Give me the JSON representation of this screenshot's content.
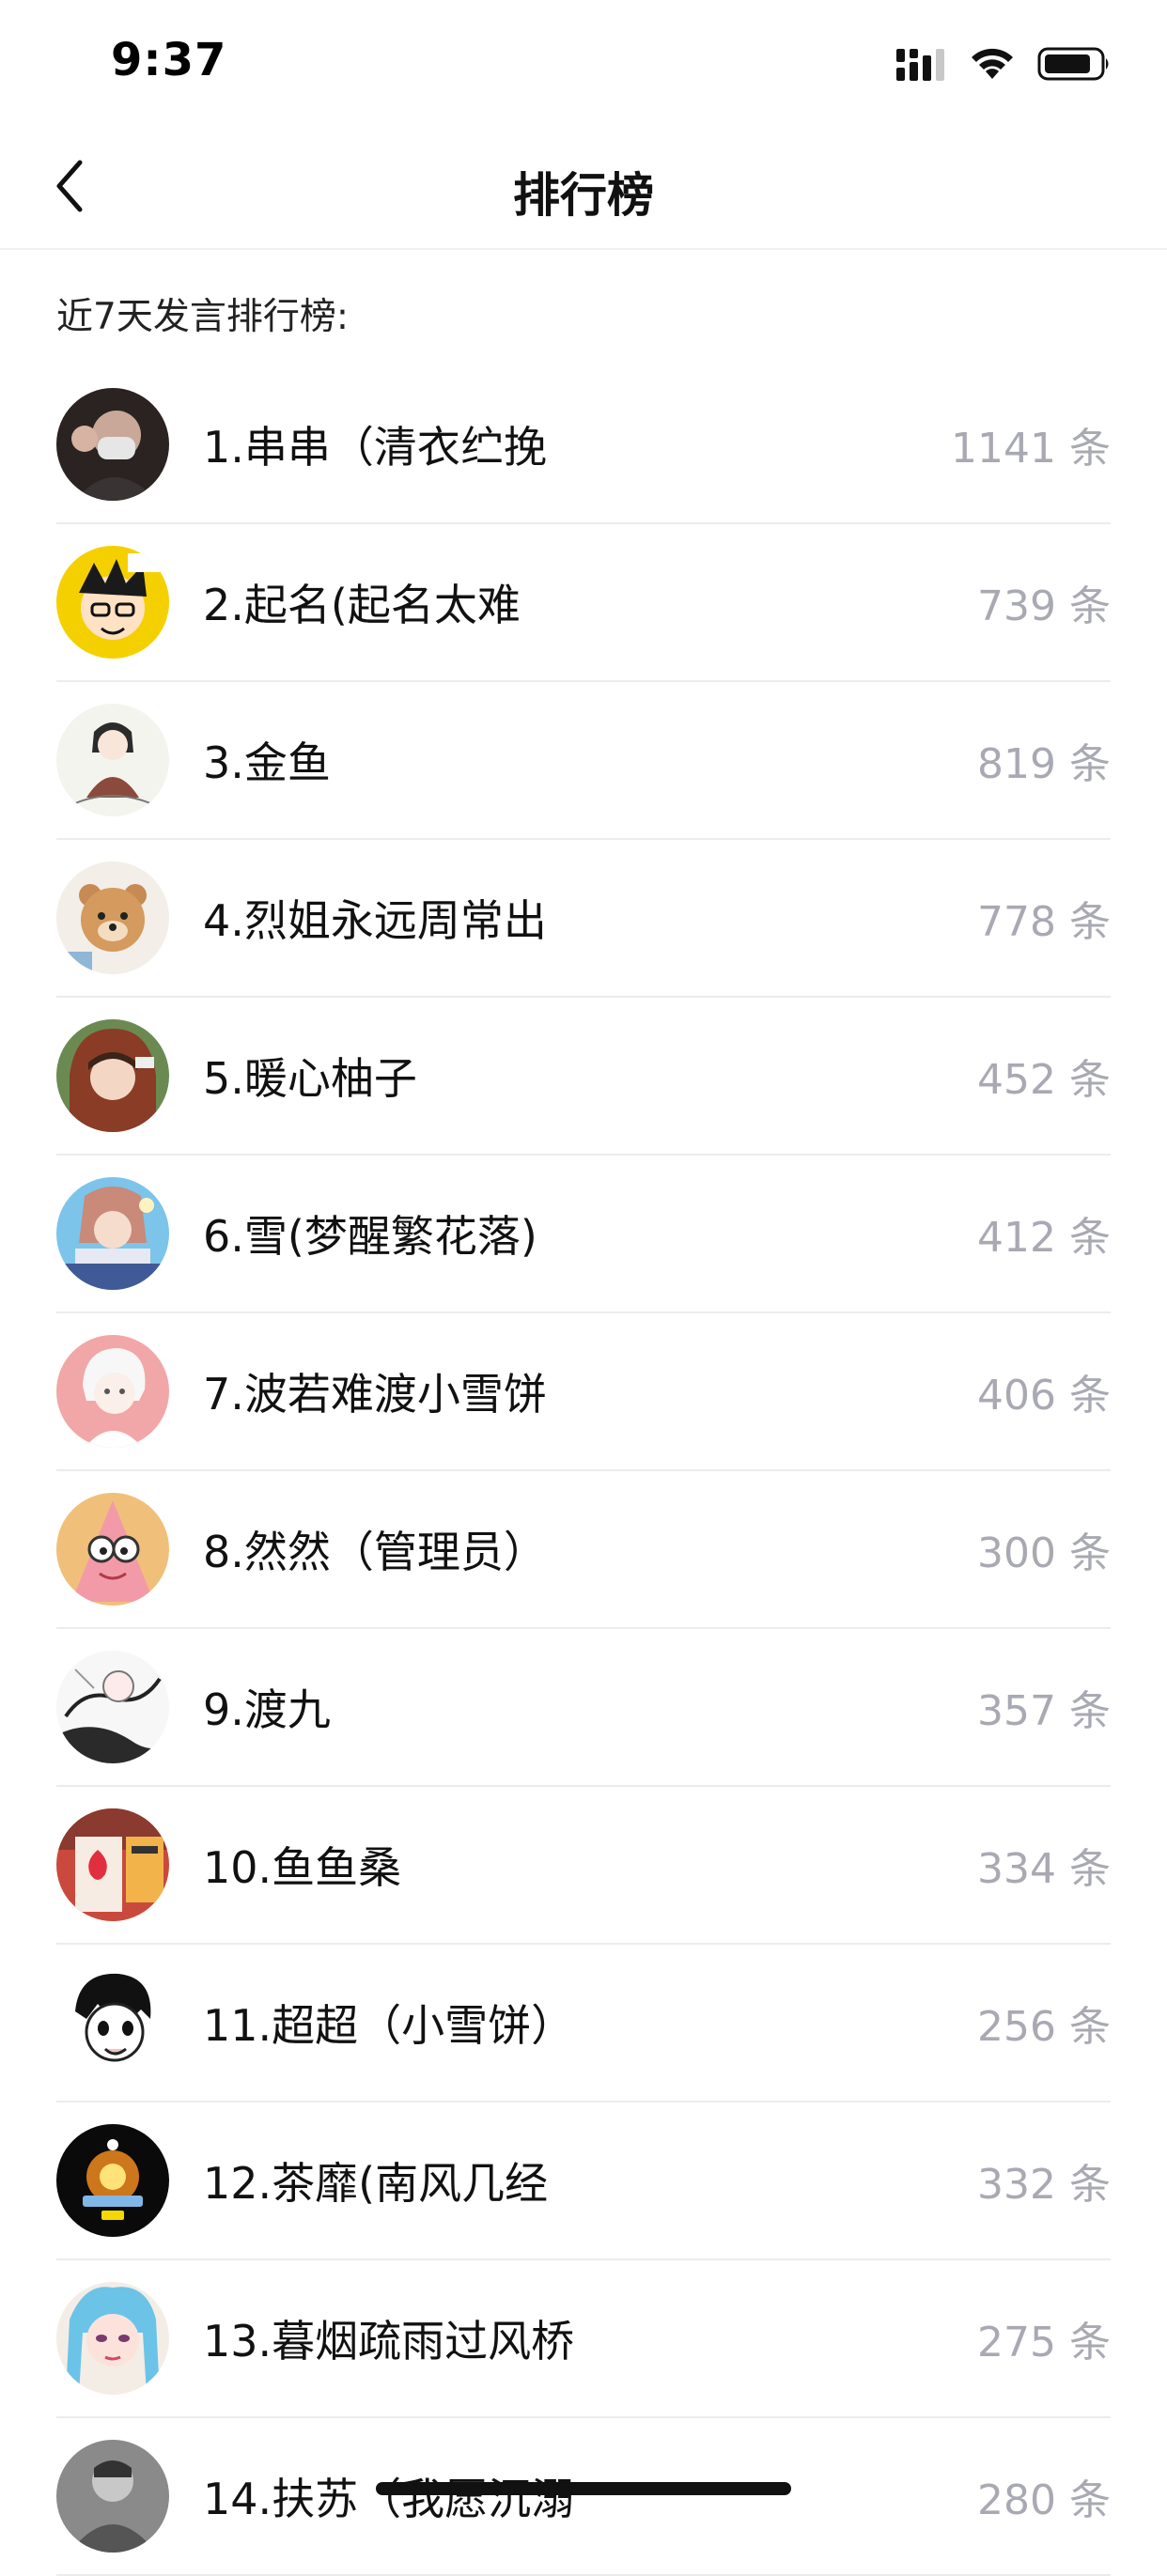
{
  "status_bar": {
    "time": "9:37"
  },
  "nav": {
    "title": "排行榜",
    "back_icon": "chevron-left-icon"
  },
  "section": {
    "header": "近7天发言排行榜:"
  },
  "count_unit": "条",
  "colors": {
    "count_text": "#a9a9b3",
    "divider": "#ececec"
  },
  "ranking": [
    {
      "name": "1.串串（清衣纻挽",
      "count": "1141",
      "avatar": "dark-photo-avatar"
    },
    {
      "name": "2.起名(起名太难",
      "count": "739",
      "avatar": "yellow-cartoon-avatar"
    },
    {
      "name": "3.金鱼",
      "count": "819",
      "avatar": "sketch-girl-avatar"
    },
    {
      "name": "4.烈姐永远周常出",
      "count": "778",
      "avatar": "bear-avatar"
    },
    {
      "name": "5.暖心柚子",
      "count": "452",
      "avatar": "anime-hood-avatar"
    },
    {
      "name": "6.雪(梦醒繁花落)",
      "count": "412",
      "avatar": "anime-blue-avatar"
    },
    {
      "name": "7.波若难渡小雪饼",
      "count": "406",
      "avatar": "anime-pink-avatar"
    },
    {
      "name": "8.然然（管理员）",
      "count": "300",
      "avatar": "patrick-avatar"
    },
    {
      "name": "9.渡九",
      "count": "357",
      "avatar": "sketch-bw-avatar"
    },
    {
      "name": "10.鱼鱼桑",
      "count": "334",
      "avatar": "strawberry-avatar"
    },
    {
      "name": "11.超超（小雪饼）",
      "count": "256",
      "avatar": "manga-boy-avatar"
    },
    {
      "name": "12.茶靡(南风几经",
      "count": "332",
      "avatar": "fire-avatar"
    },
    {
      "name": "13.暮烟疏雨过风桥",
      "count": "275",
      "avatar": "blue-hair-avatar"
    },
    {
      "name": "14.扶苏（我愿沉溺",
      "count": "280",
      "avatar": "grey-photo-avatar"
    }
  ]
}
